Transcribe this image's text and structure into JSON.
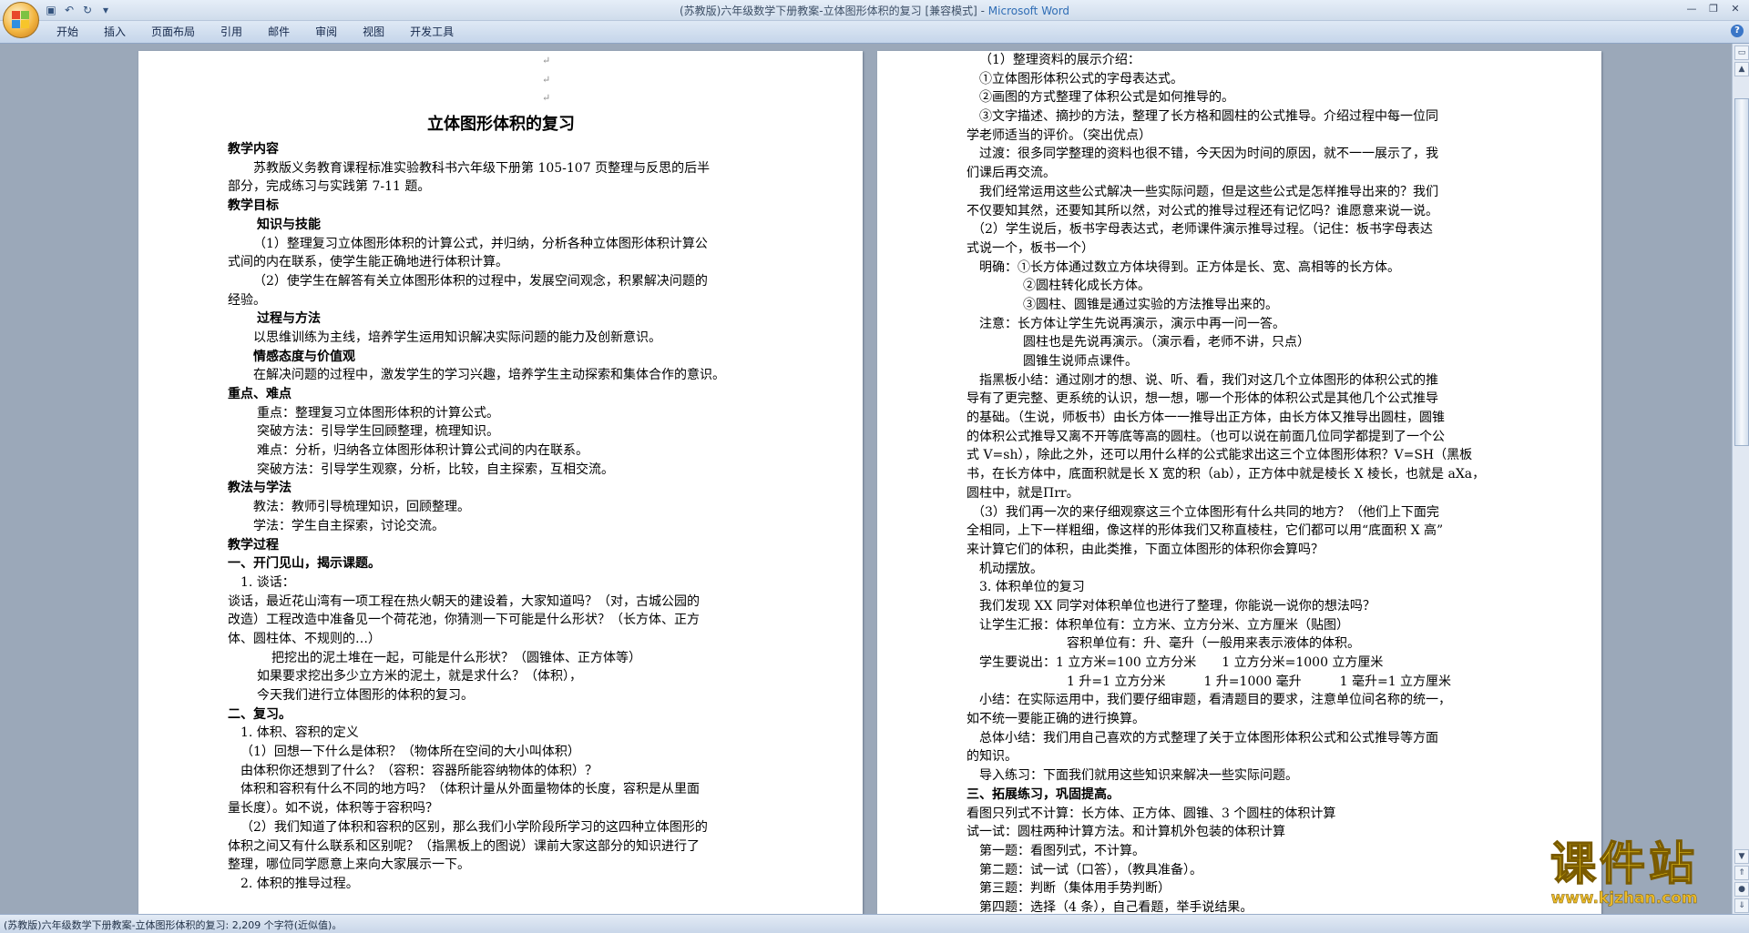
{
  "window": {
    "title": "(苏教版)六年级数学下册教案-立体图形体积的复习 [兼容模式] - ",
    "app_name": "Microsoft Word"
  },
  "ribbon": {
    "tabs": [
      "开始",
      "插入",
      "页面布局",
      "引用",
      "邮件",
      "审阅",
      "视图",
      "开发工具"
    ]
  },
  "left_page": {
    "title": "立体图形体积的复习",
    "lines": [
      "教学内容",
      "苏教版义务教育课程标准实验教科书六年级下册第 105-107 页整理与反思的后半",
      "部分，完成练习与实践第 7-11 题。",
      "教学目标",
      "知识与技能",
      "（1）整理复习立体图形体积的计算公式，并归纳，分析各种立体图形体积计算公",
      "式间的内在联系，使学生能正确地进行体积计算。",
      "（2）使学生在解答有关立体图形体积的过程中，发展空间观念，积累解决问题的",
      "经验。",
      "过程与方法",
      "以思维训练为主线，培养学生运用知识解决实际问题的能力及创新意识。",
      "情感态度与价值观",
      "在解决问题的过程中，激发学生的学习兴趣，培养学生主动探索和集体合作的意识。",
      "重点、难点",
      "重点：整理复习立体图形体积的计算公式。",
      "突破方法：引导学生回顾整理，梳理知识。",
      "难点：分析，归纳各立体图形体积计算公式间的内在联系。",
      "突破方法：引导学生观察，分析，比较，自主探索，互相交流。",
      "教法与学法",
      "教法：教师引导梳理知识，回顾整理。",
      "学法：学生自主探索，讨论交流。",
      "教学过程",
      "一、开门见山，揭示课题。",
      "1. 谈话：",
      "谈话，最近花山湾有一项工程在热火朝天的建设着，大家知道吗？（对，古城公园的",
      "改造）工程改造中准备见一个荷花池，你猜测一下可能是什么形状？（长方体、正方",
      "体、圆柱体、不规则的…）",
      "把挖出的泥土堆在一起，可能是什么形状？（圆锥体、正方体等）",
      "如果要求挖出多少立方米的泥土，就是求什么？（体积），",
      "今天我们进行立体图形的体积的复习。",
      "二、复习。",
      "1. 体积、容积的定义",
      "（1）回想一下什么是体积？（物体所在空间的大小叫体积）",
      "由体积你还想到了什么？（容积：容器所能容纳物体的体积）？",
      "体积和容积有什么不同的地方吗？（体积计量从外面量物体的长度，容积是从里面",
      "量长度）。如不说，体积等于容积吗？",
      "（2）我们知道了体积和容积的区别，那么我们小学阶段所学习的这四种立体图形的",
      "体积之间又有什么联系和区别呢？（指黑板上的图说）课前大家这部分的知识进行了",
      "整理，哪位同学愿意上来向大家展示一下。",
      "2. 体积的推导过程。"
    ]
  },
  "right_page": {
    "lines": [
      "（1）整理资料的展示介绍：",
      "①立体图形体积公式的字母表达式。",
      "②画图的方式整理了体积公式是如何推导的。",
      "③文字描述、摘抄的方法，整理了长方格和圆柱的公式推导。介绍过程中每一位同",
      "学老师适当的评价。（突出优点）",
      "过渡：很多同学整理的资料也很不错，今天因为时间的原因，就不一一展示了，我",
      "们课后再交流。",
      "我们经常运用这些公式解决一些实际问题，但是这些公式是怎样推导出来的？我们",
      "不仅要知其然，还要知其所以然，对公式的推导过程还有记忆吗？谁愿意来说一说。",
      "（2）学生说后，板书字母表达式，老师课件演示推导过程。（记住：板书字母表达",
      "式说一个，板书一个）",
      "明确：①长方体通过数立方体块得到。正方体是长、宽、高相等的长方体。",
      "②圆柱转化成长方体。",
      "③圆柱、圆锥是通过实验的方法推导出来的。",
      "注意：长方体让学生先说再演示，演示中再一问一答。",
      "圆柱也是先说再演示。（演示看，老师不讲，只点）",
      "圆锥生说师点课件。",
      "指黑板小结：通过刚才的想、说、听、看，我们对这几个立体图形的体积公式的推",
      "导有了更完整、更系统的认识，想一想，哪一个形体的体积公式是其他几个公式推导",
      "的基础。（生说，师板书）由长方体一一推导出正方体，由长方体又推导出圆柱，圆锥",
      "的体积公式推导又离不开等底等高的圆柱。（也可以说在前面几位同学都提到了一个公",
      "式 V=sh），除此之外，还可以用什么样的公式能求出这三个立体图形体积？V=SH（黑板",
      "书，在长方体中，底面积就是长 X 宽的积（ab），正方体中就是棱长 X 棱长，也就是 aXa，",
      "圆柱中，就是Πrr。",
      "（3）我们再一次的来仔细观察这三个立体图形有什么共同的地方？（他们上下面完",
      "全相同，上下一样粗细，像这样的形体我们又称直棱柱，它们都可以用“底面积 X 高”",
      "来计算它们的体积，由此类推，下面立体图形的体积你会算吗？",
      "机动摆放。",
      "3. 体积单位的复习",
      "我们发现 XX 同学对体积单位也进行了整理，你能说一说你的想法吗？",
      "让学生汇报：体积单位有：立方米、立方分米、立方厘米（贴图）",
      "容积单位有：升、毫升（一般用来表示液体的体积。",
      "学生要说出：1 立方米=100 立方分米　　1 立方分米=1000 立方厘米",
      "1 升=1 立方分米　　　1 升=1000 毫升　　　1 毫升=1 立方厘米",
      "小结：在实际运用中，我们要仔细审题，看清题目的要求，注意单位间名称的统一，",
      "如不统一要能正确的进行换算。",
      "总体小结：我们用自己喜欢的方式整理了关于立体图形体积公式和公式推导等方面",
      "的知识。",
      "导入练习：下面我们就用这些知识来解决一些实际问题。",
      "三、拓展练习，巩固提高。",
      "看图只列式不计算：长方体、正方体、圆锥、3 个圆柱的体积计算",
      "试一试：圆柱两种计算方法。和计算机外包装的体积计算",
      "第一题：看图列式，不计算。",
      "第二题：试一试（口答），（教具准备）。",
      "第三题：判断（集体用手势判断）",
      "第四题：选择（4 条），自己看题，举手说结果。"
    ]
  },
  "statusbar": {
    "text": "(苏教版)六年级数学下册教案-立体图形体积的复习: 2,209 个字符(近似值)。"
  },
  "watermark": {
    "title": "课件站",
    "url": "www.kjzhan.com"
  },
  "colors": {
    "titlebar": "#dfe9f5",
    "workspace": "#9ba8b9",
    "app_name": "#2f6db5",
    "watermark": "#f7d21f"
  }
}
